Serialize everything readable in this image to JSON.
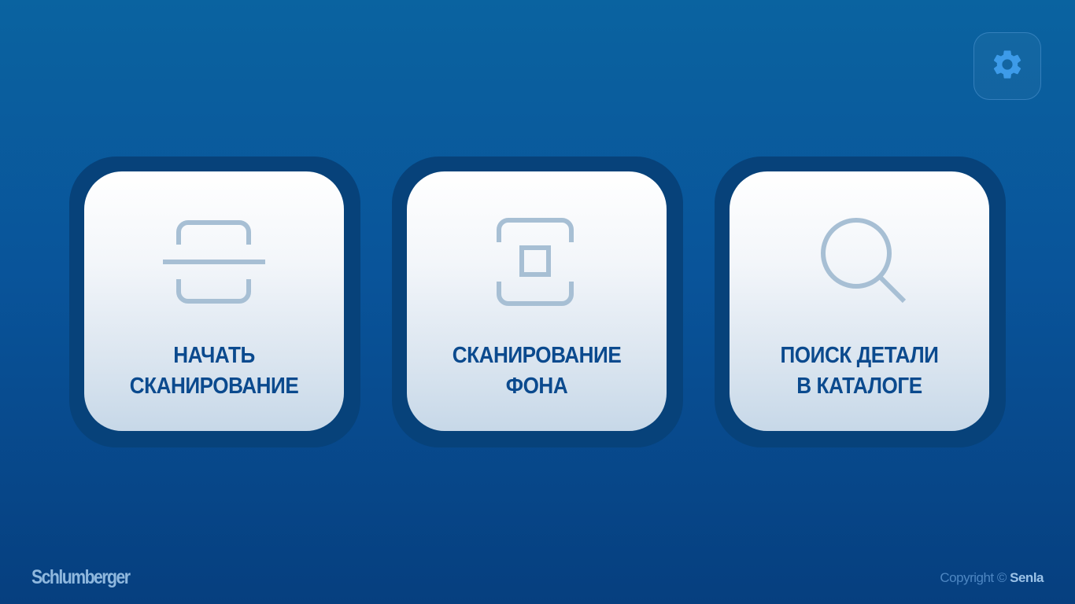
{
  "settings": {
    "icon": "gear-icon",
    "icon_color": "#3d9be9"
  },
  "tiles": [
    {
      "icon": "scan-line-icon",
      "line1": "НАЧАТЬ",
      "line2": "СКАНИРОВАНИЕ"
    },
    {
      "icon": "scan-square-icon",
      "line1": "СКАНИРОВАНИЕ",
      "line2": "ФОНА"
    },
    {
      "icon": "search-icon",
      "line1": "ПОИСК ДЕТАЛИ",
      "line2": "В КАТАЛОГЕ"
    }
  ],
  "footer": {
    "brand": "Schlumberger",
    "copyright_prefix": "Copyright ©",
    "copyright_owner": "Senla"
  },
  "colors": {
    "background_top": "#0a63a0",
    "background_bottom": "#063f7f",
    "tile_text": "#0b4a8e",
    "icon_stroke": "#a7bfd4"
  }
}
